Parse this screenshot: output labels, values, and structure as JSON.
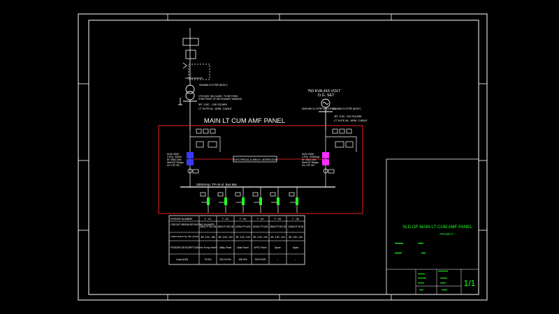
{
  "drawing": {
    "panel_title": "MAIN LT CUM AMF PANEL",
    "dg_set": {
      "rating": "750 KVA,415 VOLT",
      "label": "D.G. SET"
    },
    "transformer_notes": [
      "50X6MM GI STRIP (BODY)",
      "CTS 2000 / 5A CLASS - TO BE FIXED",
      "STAR POINT OF SECONDARY WINDING",
      "3R, 3.5C - 240 SQ.MM",
      "LT XLPE AL. ARM. CABLE"
    ],
    "dg_notes": [
      "50X6 MM CU STRIP (NEUTRAL)",
      "50X6MM GI STRIP (BODY)",
      "3R, 3.5C, 240 SQ.MM",
      "LT XLPE AL. ARM. CABLE"
    ],
    "interlock_label": "ELECTRICAL & MECH. INTERLOCK",
    "incomer_left": [
      "ACB 2000",
      "4 POL, 3000A",
      "EF 30kA 1Sec",
      "With INT Relays",
      "UV, O/P, S/C"
    ],
    "incomer_right": [
      "ACB 2000",
      "4 POL, 2000Amp",
      "EF 30kA 1Sec",
      "With INT Relays",
      "UV, O/P, S/C"
    ],
    "busbar_label": "2000Amp. TP+N Al. Bus Bar"
  },
  "feeder_table": {
    "row_headers": [
      "FEEDER NUMBER",
      "CIRCUIT BREAKER RATING IN AMPS",
      "CABLE SIZE IN SQ. MM. (ALUM)",
      "FEEDER DESCRIPTION",
      "Load (KW)"
    ],
    "columns": [
      {
        "number": "F - 01",
        "breaker": "250A FP MCCB",
        "cable": "3R, 3.5C, 185",
        "description": "Fire Pump Panel",
        "load": "75 KW"
      },
      {
        "number": "F - 02",
        "breaker": "400A FP MCCB",
        "cable": "3R, 3.5C, 240",
        "description": "Utility Panel",
        "load": "300.15 KW"
      },
      {
        "number": "F - 03",
        "breaker": "1250A FP ACB",
        "cable": "3R, 3.5C, 240",
        "description": "Main Panel",
        "load": "630 KW"
      },
      {
        "number": "F - 04",
        "breaker": "1000A TP ACB",
        "cable": "3R, 3.5C, 240",
        "description": "APFC Panel",
        "load": "500 KVAR"
      },
      {
        "number": "F - 05",
        "breaker": "250A FP MCCB",
        "cable": "3R, 3.5C, 240",
        "description": "Spare",
        "load": "--"
      },
      {
        "number": "F - 06",
        "breaker": "1250A FP ACB",
        "cable": "3R, 3.5C, 240",
        "description": "Spare",
        "load": "--"
      }
    ]
  },
  "title_block": {
    "title": "SLD OF MAIN LT CUM AMF PANEL",
    "project": "PROJECT :-",
    "sheet": "1/1"
  },
  "colors": {
    "background": "#000000",
    "line": "#ffffff",
    "panel_outline": "#ff2a2a",
    "annotation": "#22ff22",
    "breaker_blue": "#3a3aff",
    "breaker_magenta": "#ff2aff"
  }
}
